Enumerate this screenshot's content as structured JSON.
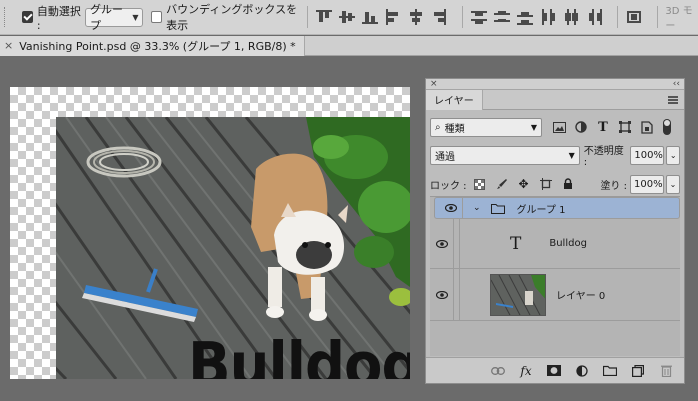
{
  "options_bar": {
    "auto_select_label": "自動選択 :",
    "auto_select_checked": true,
    "auto_select_target": "グループ",
    "bounding_box_label": "バウンディングボックスを表示",
    "bounding_box_checked": false,
    "mode_3d_label": "3D モー"
  },
  "document_tab": {
    "close_glyph": "×",
    "title": "Vanishing Point.psd @ 33.3% (グループ 1, RGB/8) *"
  },
  "canvas": {
    "text_layer_content": "Bulldog"
  },
  "layers_panel": {
    "close_glyph": "×",
    "collapse_glyph": "‹‹",
    "tab_label": "レイヤー",
    "filter_kind": "種類",
    "blend_mode": "通過",
    "opacity_label": "不透明度 :",
    "opacity_value": "100%",
    "lock_label": "ロック :",
    "fill_label": "塗り :",
    "fill_value": "100%",
    "layers": [
      {
        "name": "グループ 1",
        "type": "group",
        "selected": true,
        "visible": true
      },
      {
        "name": "Bulldog",
        "type": "text",
        "selected": false,
        "visible": true
      },
      {
        "name": "レイヤー 0",
        "type": "pixel",
        "selected": false,
        "visible": true
      }
    ],
    "footer_icons": [
      "link-icon",
      "fx-icon",
      "mask-icon",
      "adjustment-icon",
      "folder-icon",
      "new-layer-icon",
      "trash-icon"
    ],
    "fx_label": "fx"
  },
  "colors": {
    "selection": "#9cb3d4",
    "panel_bg": "#bdbdbd",
    "workspace": "#6b6b6b"
  }
}
